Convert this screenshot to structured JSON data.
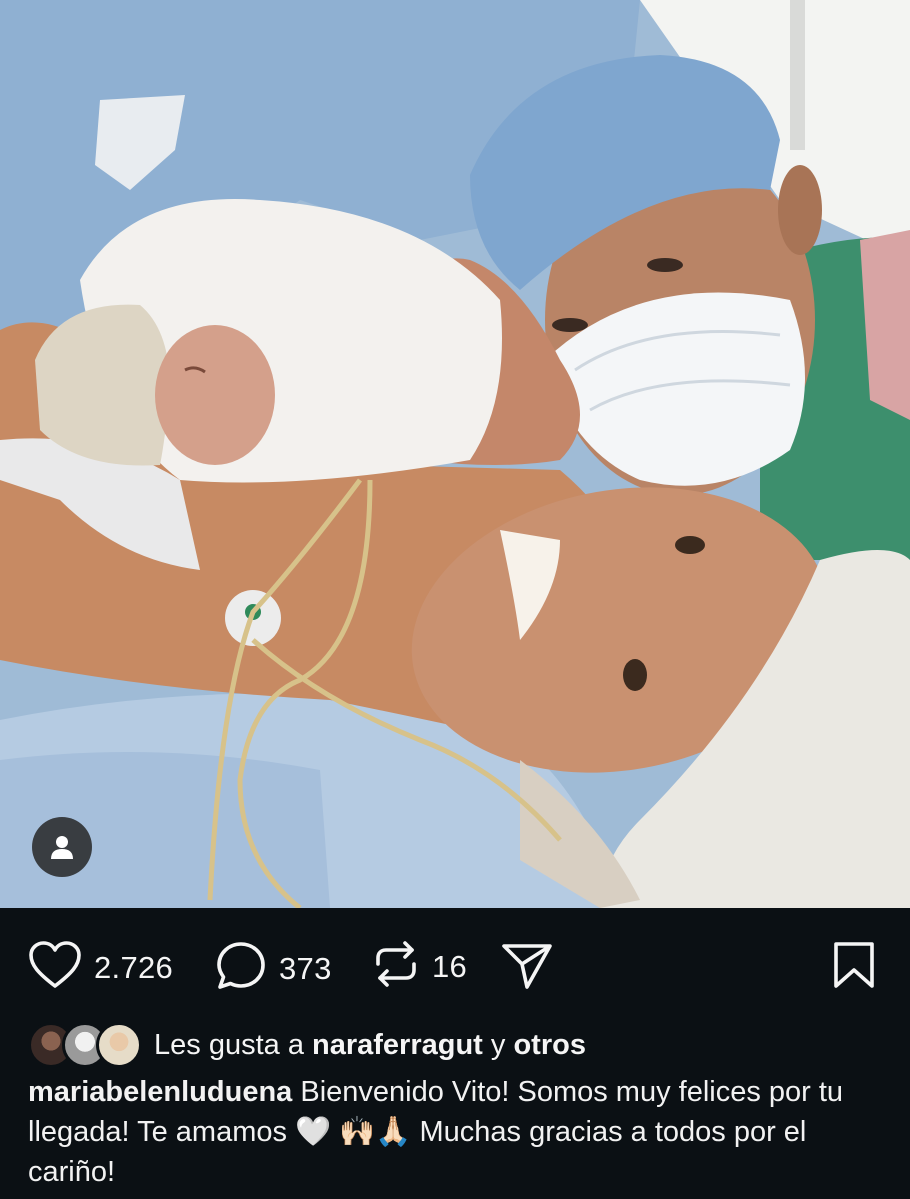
{
  "post": {
    "image_alt": "Mother, newborn baby and doctor in operating room",
    "likes_count": "2.726",
    "comments_count": "373",
    "reposts_count": "16"
  },
  "icons": {
    "like": "heart-icon",
    "comment": "comment-bubble-icon",
    "repost": "repost-icon",
    "share": "send-icon",
    "save": "bookmark-icon",
    "tags": "user-tag-icon"
  },
  "likes": {
    "prefix": "Les gusta a",
    "user": "naraferragut",
    "conjunction": "y",
    "others": "otros"
  },
  "caption": {
    "username": "mariabelenluduena",
    "text": "Bienvenido Vito! Somos muy felices por tu llegada! Te amamos 🤍 🙌🏻🙏🏻 Muchas gracias a todos por el cariño!"
  },
  "colors": {
    "background": "#0b1014",
    "text": "#f5f5f5"
  }
}
